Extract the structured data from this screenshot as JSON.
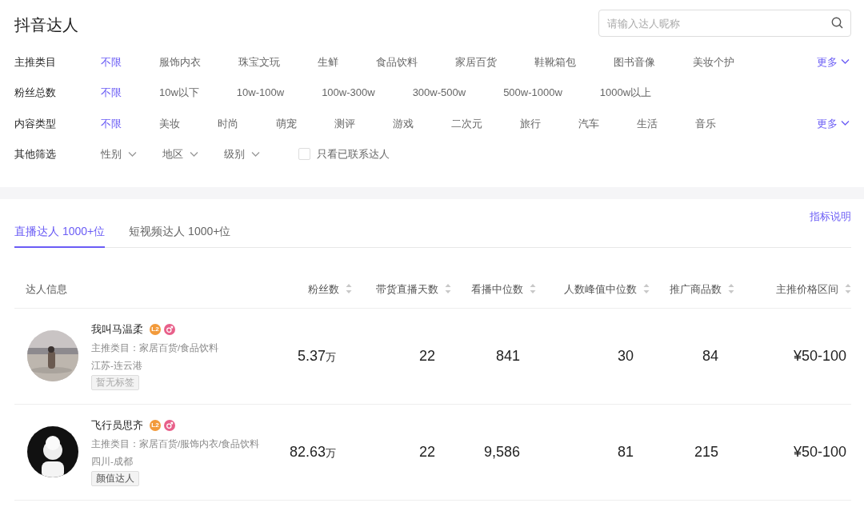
{
  "page_title": "抖音达人",
  "search": {
    "placeholder": "请输入达人昵称"
  },
  "filters": [
    {
      "label": "主推类目",
      "more": "更多",
      "options": [
        {
          "label": "不限",
          "selected": true
        },
        {
          "label": "服饰内衣",
          "selected": false
        },
        {
          "label": "珠宝文玩",
          "selected": false
        },
        {
          "label": "生鲜",
          "selected": false
        },
        {
          "label": "食品饮料",
          "selected": false
        },
        {
          "label": "家居百货",
          "selected": false
        },
        {
          "label": "鞋靴箱包",
          "selected": false
        },
        {
          "label": "图书音像",
          "selected": false
        },
        {
          "label": "美妆个护",
          "selected": false
        }
      ]
    },
    {
      "label": "粉丝总数",
      "options": [
        {
          "label": "不限",
          "selected": true
        },
        {
          "label": "10w以下",
          "selected": false
        },
        {
          "label": "10w-100w",
          "selected": false
        },
        {
          "label": "100w-300w",
          "selected": false
        },
        {
          "label": "300w-500w",
          "selected": false
        },
        {
          "label": "500w-1000w",
          "selected": false
        },
        {
          "label": "1000w以上",
          "selected": false
        }
      ]
    },
    {
      "label": "内容类型",
      "more": "更多",
      "options": [
        {
          "label": "不限",
          "selected": true
        },
        {
          "label": "美妆",
          "selected": false
        },
        {
          "label": "时尚",
          "selected": false
        },
        {
          "label": "萌宠",
          "selected": false
        },
        {
          "label": "测评",
          "selected": false
        },
        {
          "label": "游戏",
          "selected": false
        },
        {
          "label": "二次元",
          "selected": false
        },
        {
          "label": "旅行",
          "selected": false
        },
        {
          "label": "汽车",
          "selected": false
        },
        {
          "label": "生活",
          "selected": false
        },
        {
          "label": "音乐",
          "selected": false
        }
      ]
    }
  ],
  "other_filters": {
    "label": "其他筛选",
    "dropdowns": [
      "性别",
      "地区",
      "级别"
    ],
    "checkbox": {
      "label": "只看已联系达人",
      "checked": false
    }
  },
  "tabs": [
    {
      "label": "直播达人 1000+位",
      "selected": true
    },
    {
      "label": "短视频达人 1000+位",
      "selected": false
    }
  ],
  "help_link": "指标说明",
  "table": {
    "columns": [
      {
        "label": "达人信息",
        "sortable": false
      },
      {
        "label": "粉丝数",
        "sortable": true
      },
      {
        "label": "带货直播天数",
        "sortable": true
      },
      {
        "label": "看播中位数",
        "sortable": true
      },
      {
        "label": "人数峰值中位数",
        "sortable": true
      },
      {
        "label": "推广商品数",
        "sortable": true
      },
      {
        "label": "主推价格区间",
        "sortable": true
      }
    ],
    "rows": [
      {
        "name": "我叫马温柔",
        "level_badge": "L2",
        "category": "主推类目：家居百货/食品饮料",
        "location": "江苏-连云港",
        "tag": {
          "label": "暂无标签",
          "muted": true
        },
        "fans": "5.37",
        "fans_unit": "万",
        "live_days": "22",
        "view_median": "841",
        "peak_median": "30",
        "products": "84",
        "price_range": "¥50-100"
      },
      {
        "name": "飞行员思齐",
        "level_badge": "L2",
        "category": "主推类目：家居百货/服饰内衣/食品饮料",
        "location": "四川-成都",
        "tag": {
          "label": "颜值达人",
          "muted": false
        },
        "fans": "82.63",
        "fans_unit": "万",
        "live_days": "22",
        "view_median": "9,586",
        "peak_median": "81",
        "products": "215",
        "price_range": "¥50-100"
      }
    ]
  }
}
